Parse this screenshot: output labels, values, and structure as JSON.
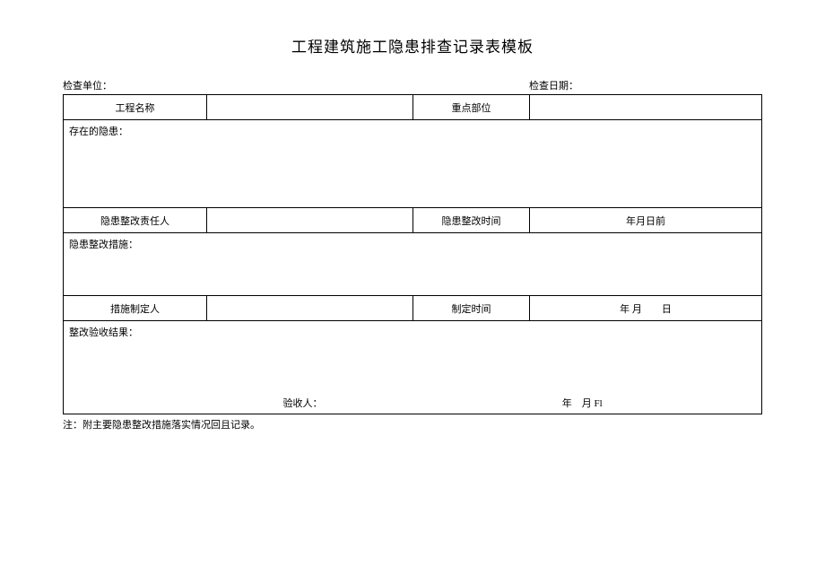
{
  "title": "工程建筑施工隐患排查记录表模板",
  "header": {
    "inspect_unit_label": "检查单位：",
    "inspect_date_label": "检查日期："
  },
  "row1": {
    "project_name_label": "工程名称",
    "project_name_value": "",
    "key_part_label": "重点部位",
    "key_part_value": ""
  },
  "section_hazard": {
    "label": "存在的隐患：",
    "value": ""
  },
  "row_resp": {
    "responsible_label": "隐患整改责任人",
    "responsible_value": "",
    "rectify_time_label": "隐患整改时间",
    "rectify_time_value": "年月日前"
  },
  "section_measures": {
    "label": "隐患整改措施：",
    "value": ""
  },
  "row_maker": {
    "maker_label": "措施制定人",
    "maker_value": "",
    "make_time_label": "制定时间",
    "make_time_value": "年 月　　日"
  },
  "section_result": {
    "label": "整改验收结果：",
    "acceptor_label": "验收人：",
    "date_text": "年　月 Fl"
  },
  "footer": "注：附主要隐患整改措施落实情况回且记录。"
}
